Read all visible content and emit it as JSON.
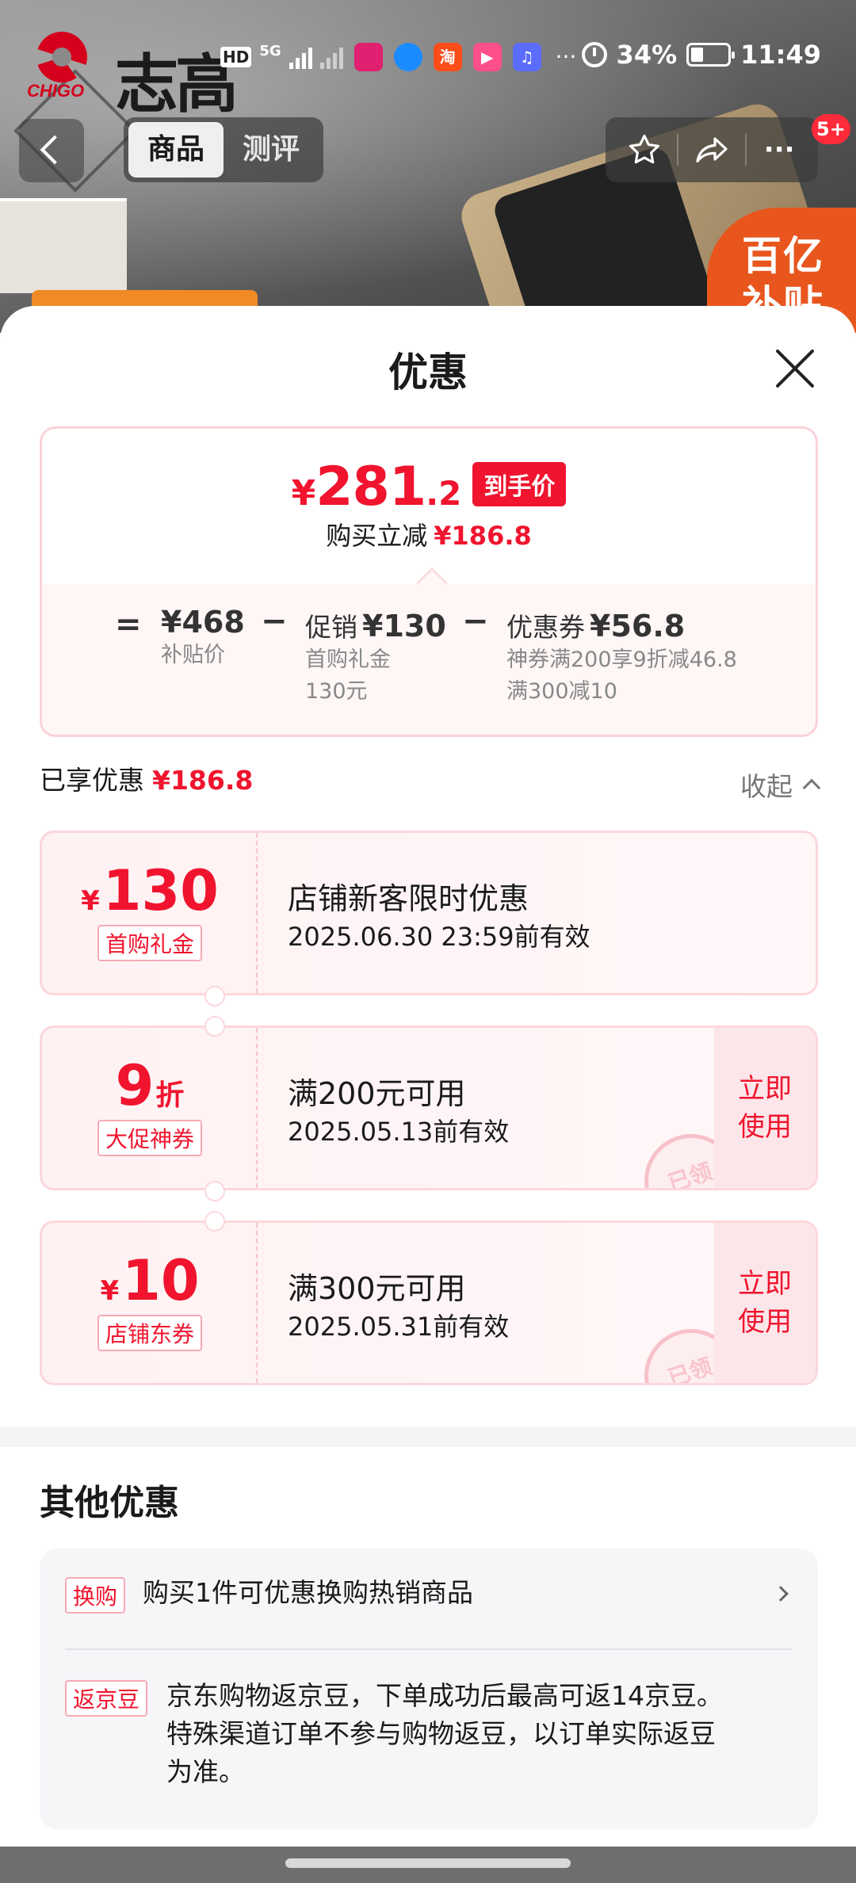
{
  "background": {
    "brand_cn": "志高",
    "brand_en": "CHIGO",
    "subsidy_badge": "百亿\n补贴"
  },
  "statusbar": {
    "network": "HD",
    "signal_label": "5G",
    "battery": "34%",
    "battery_level": 0.34,
    "time": "11:49",
    "app_icons": [
      "tmall-icon",
      "alipay-icon",
      "taobao-icon",
      "video-icon",
      "music-icon"
    ],
    "app_icon_text": [
      "",
      "",
      "淘",
      "▶",
      "♫"
    ],
    "more": "···"
  },
  "nav": {
    "tabs": [
      {
        "label": "商品",
        "active": true
      },
      {
        "label": "测评",
        "active": false
      }
    ],
    "more": "···",
    "badge": "5+"
  },
  "sheet": {
    "title": "优惠",
    "price": {
      "yen": "¥",
      "final_int": "281",
      "final_dec": ".2",
      "final_tag": "到手价",
      "save_label": "购买立减",
      "save_amount": "¥186.8",
      "equals": "=",
      "minus": "−",
      "base_value": "¥468",
      "base_label": "补贴价",
      "promo_label": "促销",
      "promo_value": "¥130",
      "promo_sub1": "首购礼金",
      "promo_sub2": "130元",
      "coupon_label": "优惠券",
      "coupon_value": "¥56.8",
      "coupon_sub1": "神券满200享9折减46.8",
      "coupon_sub2": "满300减10"
    },
    "enjoyed_label": "已享优惠",
    "enjoyed_amount": "¥186.8",
    "collapse_label": "收起",
    "coupons": [
      {
        "yen": "¥",
        "num": "130",
        "unit": "",
        "type": "首购礼金",
        "title": "店铺新客限时优惠",
        "expire": "2025.06.30 23:59前有效",
        "action": "",
        "stamp": ""
      },
      {
        "yen": "",
        "num": "9",
        "unit": "折",
        "type": "大促神券",
        "title": "满200元可用",
        "expire": "2025.05.13前有效",
        "action": "立即使用",
        "stamp": "已领"
      },
      {
        "yen": "¥",
        "num": "10",
        "unit": "",
        "type": "店铺东券",
        "title": "满300元可用",
        "expire": "2025.05.31前有效",
        "action": "立即使用",
        "stamp": "已领"
      }
    ],
    "other_title": "其他优惠",
    "other": [
      {
        "tag": "换购",
        "text": "购买1件可优惠换购热销商品"
      },
      {
        "tag": "返京豆",
        "text": "京东购物返京豆，下单成功后最高可返14京豆。特殊渠道订单不参与购物返豆，以订单实际返豆为准。"
      }
    ]
  }
}
